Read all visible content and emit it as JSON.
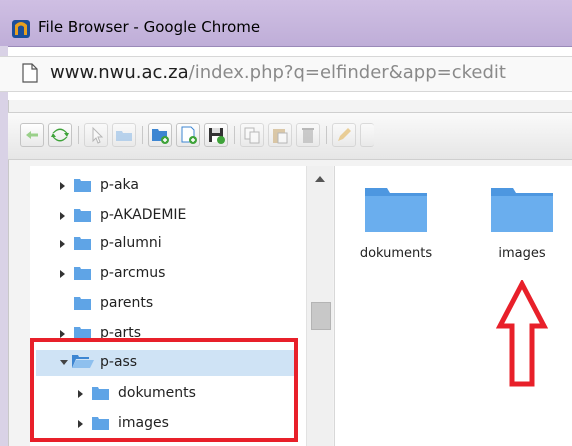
{
  "window": {
    "title": "File Browser - Google Chrome",
    "url_host": "www.nwu.ac.za",
    "url_path": "/index.php?q=elfinder&app=ckedit"
  },
  "toolbar": {
    "buttons": [
      "back-icon",
      "reload-icon",
      "select-icon",
      "open-icon",
      "new-folder-icon",
      "new-file-icon",
      "upload-icon",
      "copy-icon",
      "paste-icon",
      "delete-icon",
      "edit-icon"
    ]
  },
  "tree": {
    "items": [
      {
        "label": "p-aka",
        "expanded": false
      },
      {
        "label": "p-AKADEMIE",
        "expanded": false
      },
      {
        "label": "p-alumni",
        "expanded": false
      },
      {
        "label": "p-arcmus",
        "expanded": false
      },
      {
        "label": "parents",
        "expanded": null
      },
      {
        "label": "p-arts",
        "expanded": false
      },
      {
        "label": "p-ass",
        "expanded": true
      },
      {
        "label": "dokuments",
        "expanded": false
      },
      {
        "label": "images",
        "expanded": false
      }
    ]
  },
  "files": [
    {
      "name": "dokuments"
    },
    {
      "name": "images"
    }
  ],
  "colors": {
    "folder": "#5fa4e6",
    "folder_dark": "#3d86d2",
    "selection": "#cfe3f5",
    "annotation": "#e8202a"
  }
}
